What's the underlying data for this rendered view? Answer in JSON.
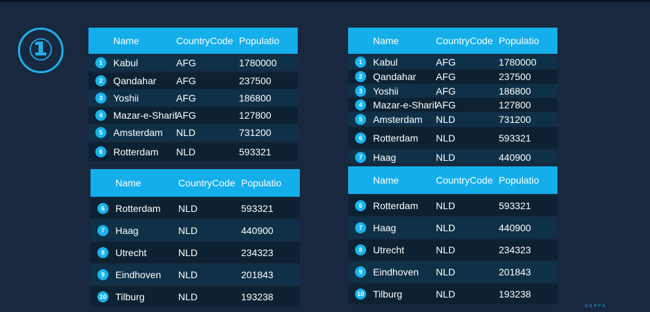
{
  "badge": "①",
  "watermark": "ＤＡＰＰＡ",
  "tables": [
    {
      "headers": [
        "Name",
        "CountryCode",
        "Population"
      ],
      "rows": [
        {
          "no": "1",
          "name": "Kabul",
          "code": "AFG",
          "pop": "1780000"
        },
        {
          "no": "2",
          "name": "Qandahar",
          "code": "AFG",
          "pop": "237500"
        },
        {
          "no": "3",
          "name": "Yoshii",
          "code": "AFG",
          "pop": "186800"
        },
        {
          "no": "4",
          "name": "Mazar-e-Sharif",
          "code": "AFG",
          "pop": "127800"
        },
        {
          "no": "5",
          "name": "Amsterdam",
          "code": "NLD",
          "pop": "731200"
        },
        {
          "no": "6",
          "name": "Rotterdam",
          "code": "NLD",
          "pop": "593321"
        }
      ]
    },
    {
      "headers": [
        "Name",
        "CountryCode",
        "Population"
      ],
      "rows": [
        {
          "no": "6",
          "name": "Rotterdam",
          "code": "NLD",
          "pop": "593321"
        },
        {
          "no": "7",
          "name": "Haag",
          "code": "NLD",
          "pop": "440900"
        },
        {
          "no": "8",
          "name": "Utrecht",
          "code": "NLD",
          "pop": "234323"
        },
        {
          "no": "9",
          "name": "Eindhoven",
          "code": "NLD",
          "pop": "201843"
        },
        {
          "no": "10",
          "name": "Tilburg",
          "code": "NLD",
          "pop": "193238"
        }
      ]
    },
    {
      "headers": [
        "Name",
        "CountryCode",
        "Population"
      ],
      "rows": [
        {
          "no": "1",
          "name": "Kabul",
          "code": "AFG",
          "pop": "1780000"
        },
        {
          "no": "2",
          "name": "Qandahar",
          "code": "AFG",
          "pop": "237500"
        },
        {
          "no": "3",
          "name": "Yoshii",
          "code": "AFG",
          "pop": "186800"
        },
        {
          "no": "4",
          "name": "Mazar-e-Sharif",
          "code": "AFG",
          "pop": "127800"
        },
        {
          "no": "5",
          "name": "Amsterdam",
          "code": "NLD",
          "pop": "731200"
        },
        {
          "no": "6",
          "name": "Rotterdam",
          "code": "NLD",
          "pop": "593321"
        },
        {
          "no": "7",
          "name": "Haag",
          "code": "NLD",
          "pop": "440900"
        }
      ]
    },
    {
      "headers": [
        "Name",
        "CountryCode",
        "Population"
      ],
      "rows": [
        {
          "no": "6",
          "name": "Rotterdam",
          "code": "NLD",
          "pop": "593321"
        },
        {
          "no": "7",
          "name": "Haag",
          "code": "NLD",
          "pop": "440900"
        },
        {
          "no": "8",
          "name": "Utrecht",
          "code": "NLD",
          "pop": "234323"
        },
        {
          "no": "9",
          "name": "Eindhoven",
          "code": "NLD",
          "pop": "201843"
        },
        {
          "no": "10",
          "name": "Tilburg",
          "code": "NLD",
          "pop": "193238"
        }
      ]
    }
  ]
}
